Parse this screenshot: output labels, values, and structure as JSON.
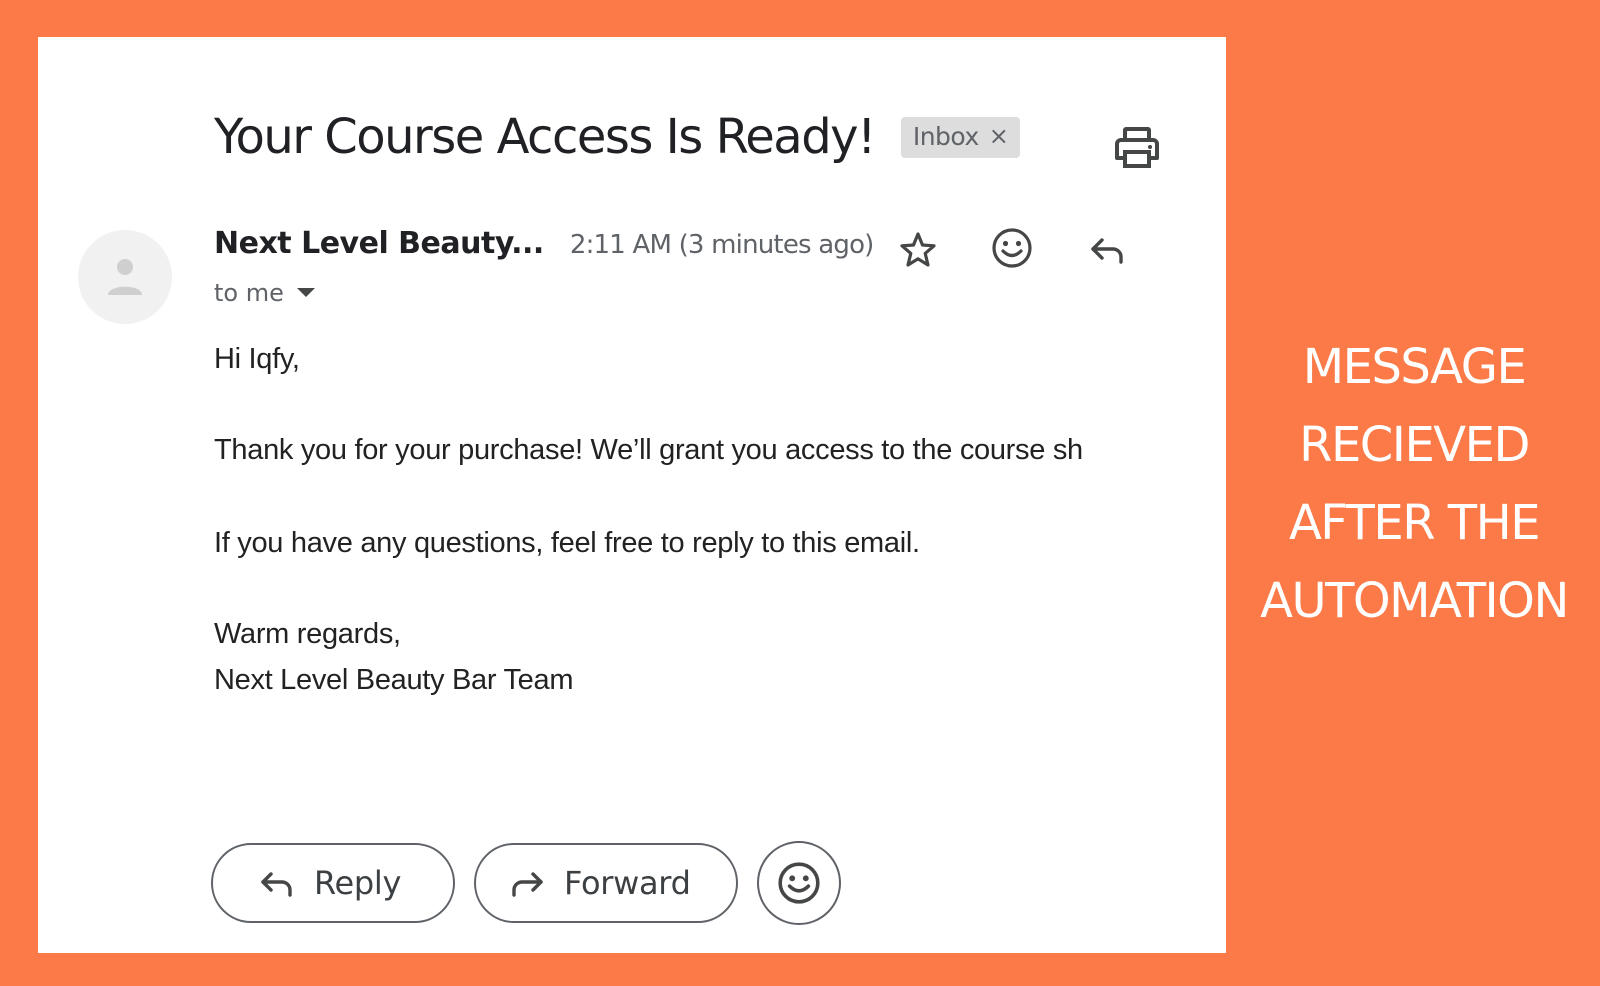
{
  "email": {
    "subject": "Your Course Access Is Ready!",
    "label_chip": "Inbox",
    "label_chip_close": "×",
    "sender_name": "Next Level Beauty...",
    "timestamp": "2:11 AM (3 minutes ago)",
    "recipient": "to me",
    "body": {
      "greeting": "Hi Iqfy,",
      "line1": "Thank you for your purchase! We’ll grant you access to the course sh",
      "line2": "If you have any questions, feel free to reply to this email.",
      "signoff": "Warm regards,",
      "signature": "Next Level Beauty Bar Team"
    },
    "actions": {
      "reply_label": "Reply",
      "forward_label": "Forward"
    }
  },
  "caption": {
    "lines": [
      "MESSAGE",
      "RECIEVED",
      "AFTER THE",
      "AUTOMATION"
    ]
  },
  "icons": {
    "print": "print-icon",
    "star": "star-icon",
    "emoji": "emoji-icon",
    "reply": "reply-icon",
    "forward": "forward-icon",
    "avatar": "person-icon",
    "caret": "caret-down-icon"
  },
  "colors": {
    "background": "#fb7a47",
    "panel": "#ffffff",
    "text_primary": "#202124",
    "text_secondary": "#5f6368",
    "chip_background": "#dddddd"
  }
}
